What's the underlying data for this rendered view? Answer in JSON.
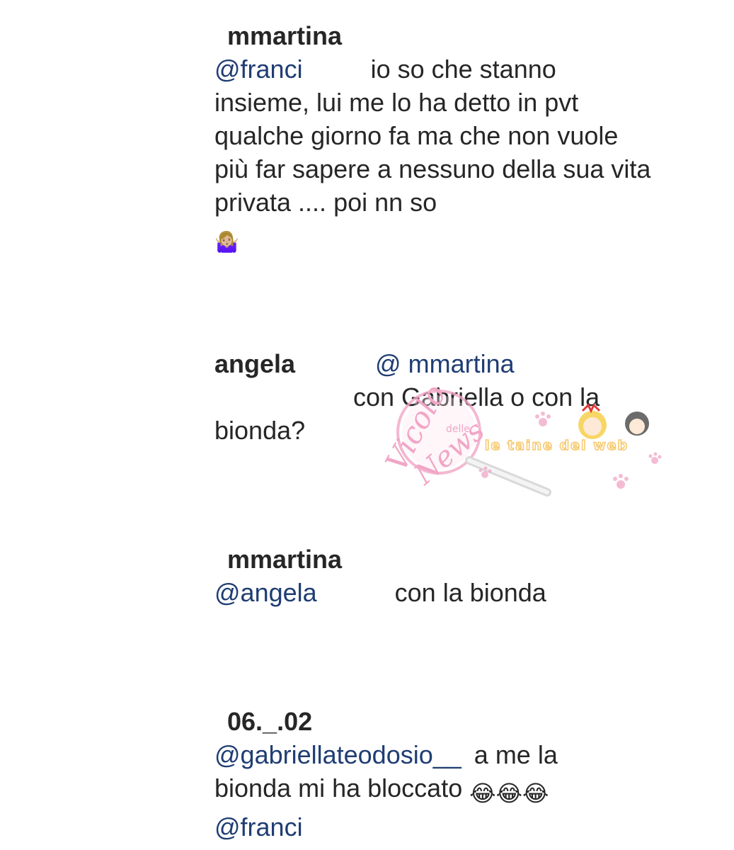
{
  "comments": [
    {
      "username": "mmartina",
      "mention": "@franci",
      "text_first": "io so che stanno",
      "text_rest": "insieme, lui me lo ha detto in pvt qualche giorno fa ma che non vuole più far sapere a nessuno della sua vita privata .... poi nn so",
      "emoji": "🤷🏼‍♀️"
    },
    {
      "username": "angela",
      "mention": "@  mmartina",
      "text_first": "con Gabriella o con la",
      "text_rest": "bionda?"
    },
    {
      "username": "mmartina",
      "mention": "@angela",
      "text_first": "con la bionda"
    },
    {
      "username": "06._.02",
      "mention": "@gabriellateodosio__",
      "text_first": "a me la",
      "text_rest": "bionda mi ha bloccato",
      "emoji": "😂😂😂",
      "mention_end": "@franci"
    }
  ],
  "watermark": {
    "brand_line1": "Vicolo",
    "brand_small": "delle",
    "brand_line2": "News",
    "partner": "le taine del web",
    "pink_color": "#f1a6c6"
  },
  "colors": {
    "mention": "#1f3d73",
    "text": "#262626",
    "background": "#ffffff"
  }
}
